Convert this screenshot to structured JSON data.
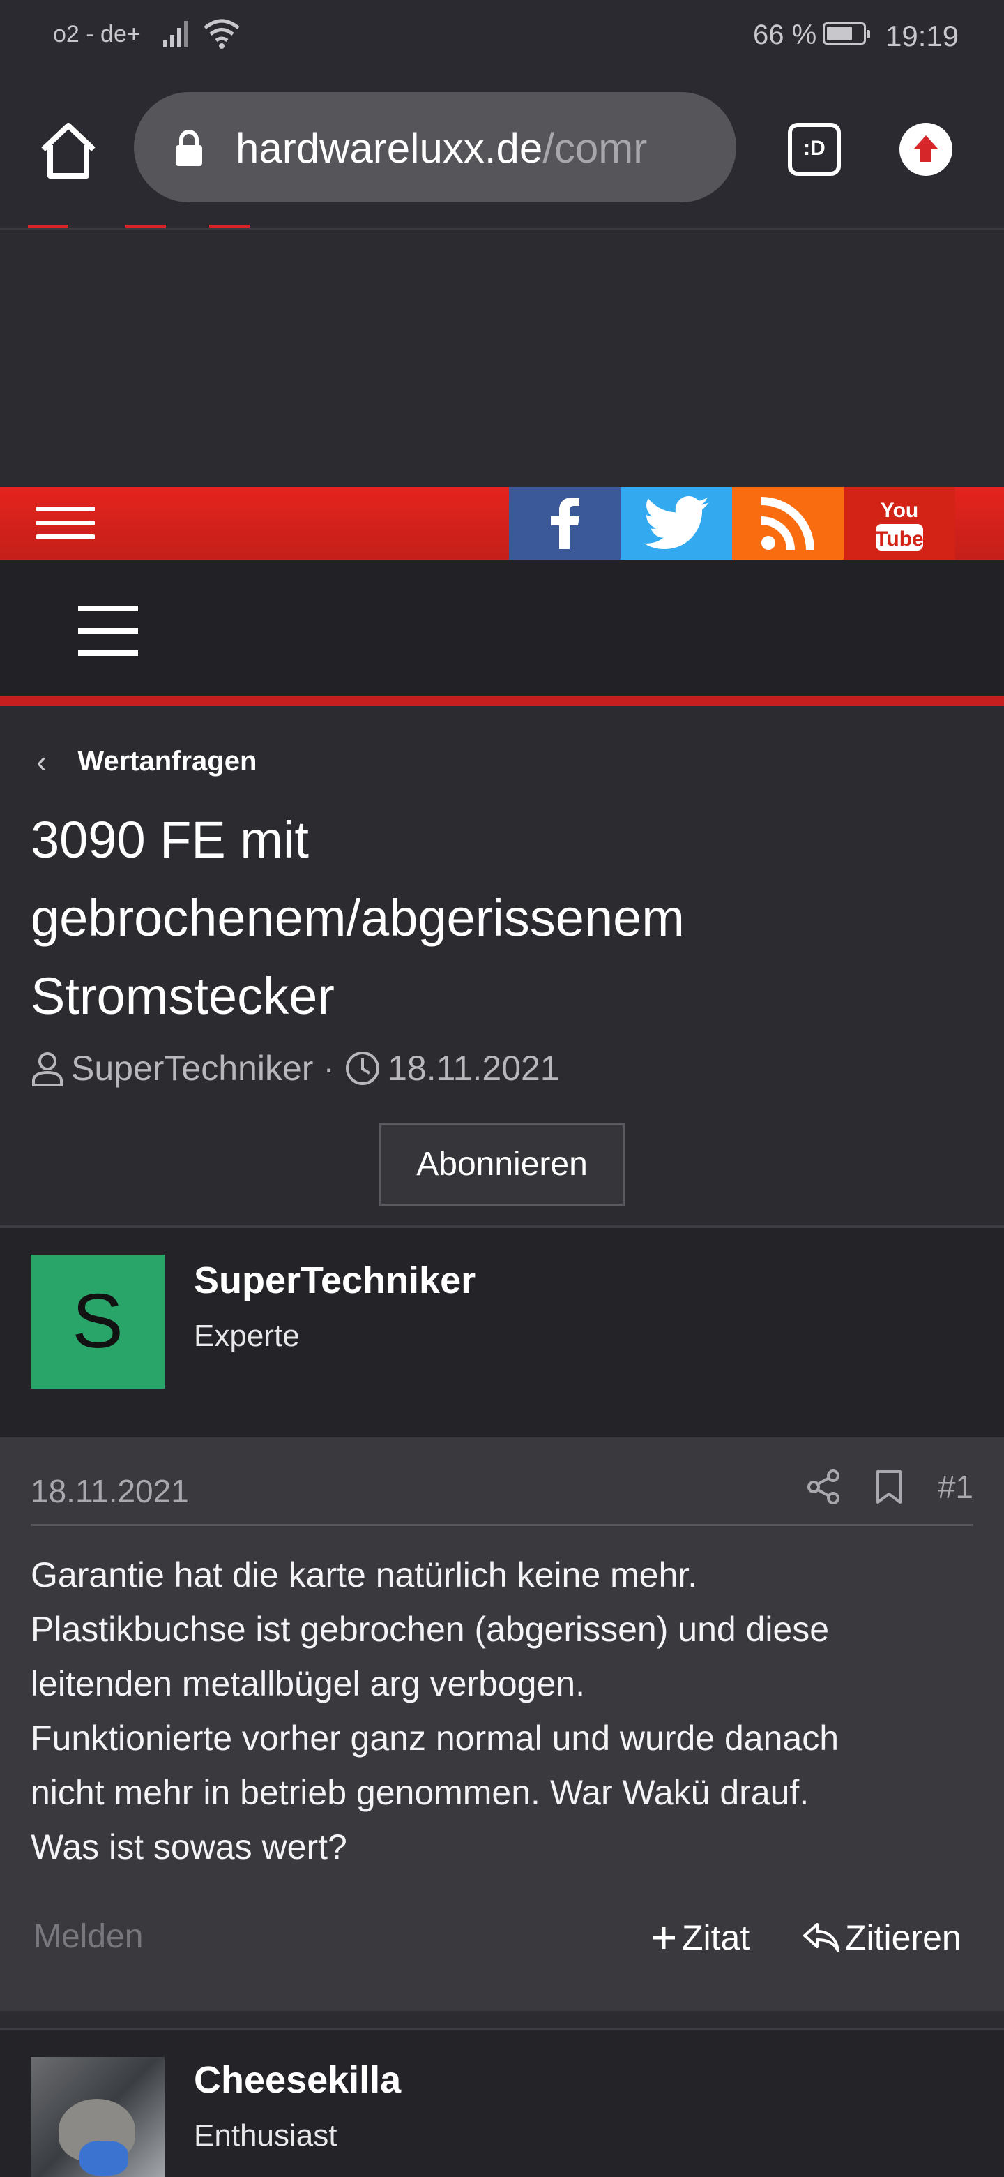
{
  "status_bar": {
    "carrier": "o2 - de+",
    "battery_pct": "66 %",
    "time": "19:19"
  },
  "browser": {
    "url_host": "hardwareluxx.de",
    "url_path": "/comr",
    "tab_label": ":D"
  },
  "breadcrumb": {
    "label": "Wertanfragen"
  },
  "thread": {
    "title": "3090 FE mit gebrochenem/abgerissenem Stromstecker",
    "author": "SuperTechniker",
    "meta_sep": "·",
    "date": "18.11.2021",
    "subscribe_label": "Abonnieren"
  },
  "post1": {
    "avatar_letter": "S",
    "avatar_color": "#2aa56a",
    "username": "SuperTechniker",
    "user_title": "Experte",
    "date": "18.11.2021",
    "post_number": "#1",
    "lines": [
      "Garantie hat die karte natürlich keine mehr.",
      "Plastikbuchse ist gebrochen (abgerissen) und diese",
      "leitenden metallbügel arg verbogen.",
      "Funktionierte vorher ganz normal und wurde danach",
      "nicht mehr in betrieb genommen. War Wakü drauf.",
      "Was ist sowas wert?"
    ],
    "report_label": "Melden",
    "quote_plus_label": "Zitat",
    "reply_label": "Zitieren"
  },
  "post2": {
    "username": "Cheesekilla",
    "user_title": "Enthusiast"
  },
  "colors": {
    "accent_red": "#c5201f",
    "facebook": "#3b5998",
    "twitter": "#33aaf0",
    "rss": "#f96c10",
    "youtube": "#d32216"
  },
  "social_icons": [
    "facebook-icon",
    "twitter-icon",
    "rss-icon",
    "youtube-icon"
  ]
}
